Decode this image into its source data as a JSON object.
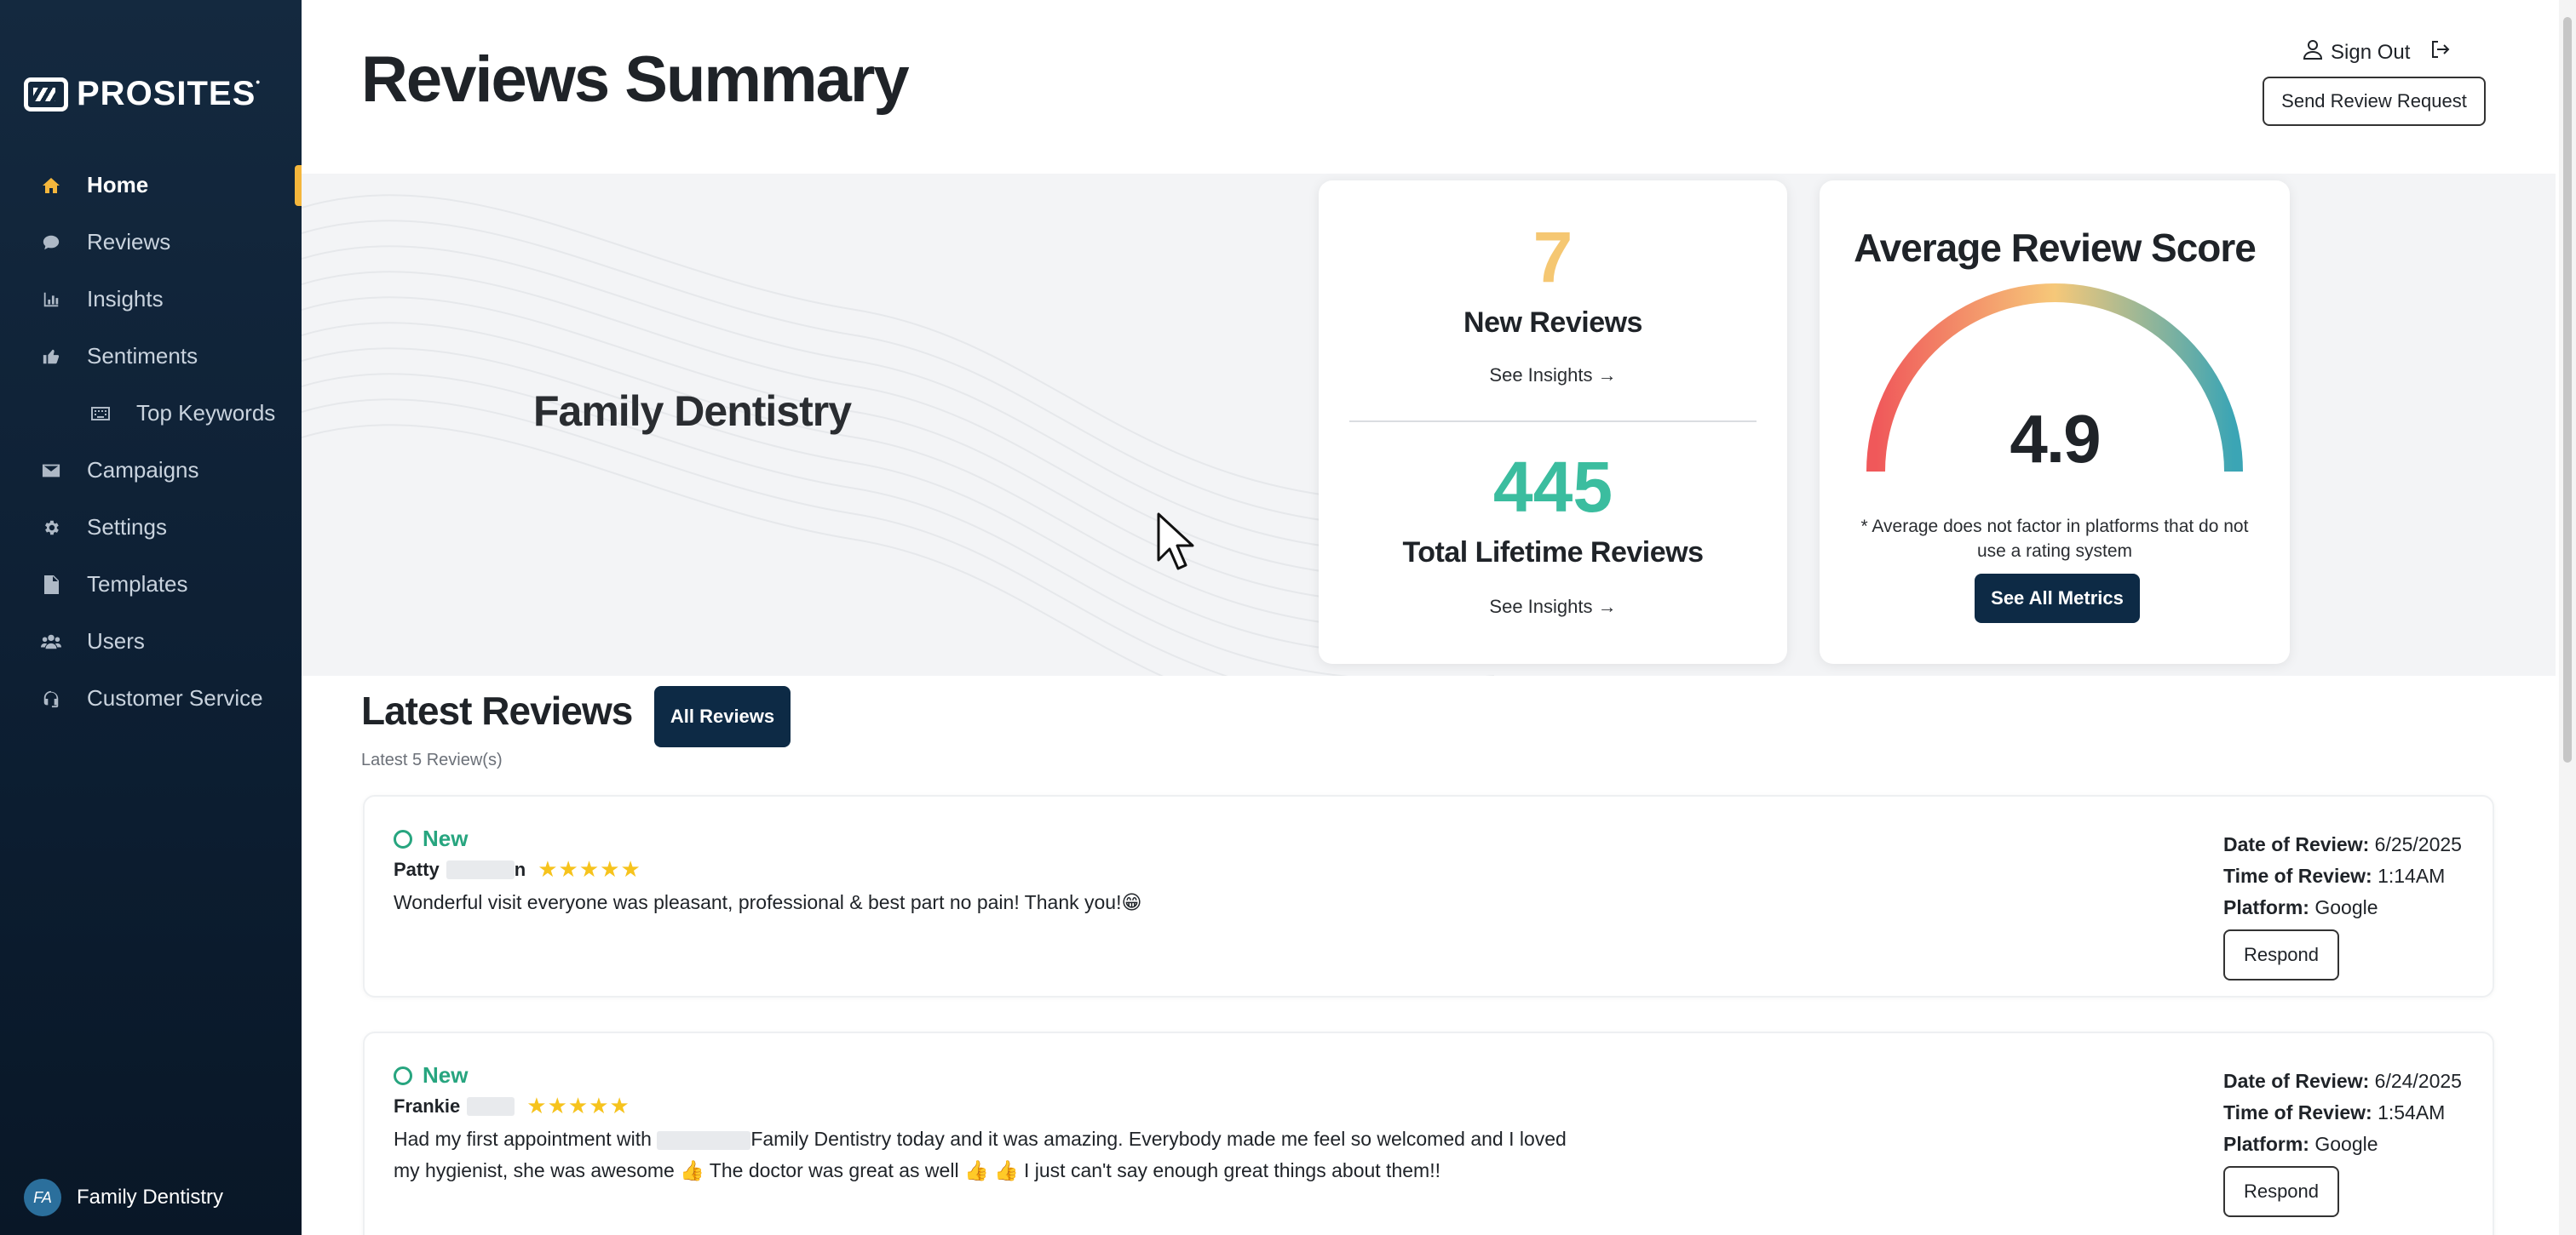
{
  "brand": {
    "logo_text": "PROSITES"
  },
  "sidebar": {
    "items": [
      {
        "label": "Home",
        "icon": "home-icon",
        "active": true
      },
      {
        "label": "Reviews",
        "icon": "chat-bubble-icon",
        "active": false
      },
      {
        "label": "Insights",
        "icon": "bar-chart-icon",
        "active": false
      },
      {
        "label": "Sentiments",
        "icon": "thumbs-up-icon",
        "active": false
      },
      {
        "label": "Top Keywords",
        "icon": "keyboard-icon",
        "active": false,
        "sub": true
      },
      {
        "label": "Campaigns",
        "icon": "envelope-icon",
        "active": false
      },
      {
        "label": "Settings",
        "icon": "gear-icon",
        "active": false
      },
      {
        "label": "Templates",
        "icon": "document-icon",
        "active": false
      },
      {
        "label": "Users",
        "icon": "users-icon",
        "active": false
      },
      {
        "label": "Customer Service",
        "icon": "headset-icon",
        "active": false
      }
    ],
    "user": {
      "initials": "FA",
      "name": "Family Dentistry"
    }
  },
  "header": {
    "title": "Reviews Summary",
    "sign_out": "Sign Out",
    "send_request": "Send Review Request"
  },
  "hero": {
    "practice_name": "Family Dentistry"
  },
  "counts": {
    "new_reviews": "7",
    "new_reviews_label": "New Reviews",
    "see_insights_1": "See Insights →",
    "total_reviews": "445",
    "total_reviews_label": "Total Lifetime Reviews",
    "see_insights_2": "See Insights →"
  },
  "score": {
    "title": "Average Review Score",
    "value": "4.9",
    "note": "* Average does not factor in platforms that do not use a rating system",
    "metrics_button": "See All Metrics",
    "gauge_colors": [
      "#f0585a",
      "#f6c879",
      "#3ba5b5"
    ]
  },
  "latest": {
    "title": "Latest Reviews",
    "all_button": "All Reviews",
    "subtitle": "Latest 5 Review(s)"
  },
  "reviews": [
    {
      "status": "New",
      "name": "Patty",
      "name_suffix": "n",
      "stars": "★★★★★",
      "text": "Wonderful visit everyone was pleasant, professional & best part no pain! Thank you!😁",
      "date_label": "Date of Review:",
      "date": "6/25/2025",
      "time_label": "Time of Review:",
      "time": "1:14AM",
      "platform_label": "Platform:",
      "platform": "Google",
      "respond": "Respond"
    },
    {
      "status": "New",
      "name": "Frankie",
      "name_suffix": "",
      "stars": "★★★★★",
      "text_a": "Had my first appointment with",
      "text_b": "Family Dentistry today and it was amazing. Everybody made me feel so welcomed and I loved my hygienist, she was awesome 👍 The doctor was great as well 👍 👍 I just can't say enough great things about them!!",
      "date_label": "Date of Review:",
      "date": "6/24/2025",
      "time_label": "Time of Review:",
      "time": "1:54AM",
      "platform_label": "Platform:",
      "platform": "Google",
      "respond": "Respond"
    }
  ],
  "colors": {
    "sidebar_bg": "#0d1f33",
    "accent": "#f4b63c",
    "new_count": "#f5c772",
    "total_count": "#3bbd9f",
    "status_new": "#27a57f",
    "button_dark": "#0d2a45"
  }
}
